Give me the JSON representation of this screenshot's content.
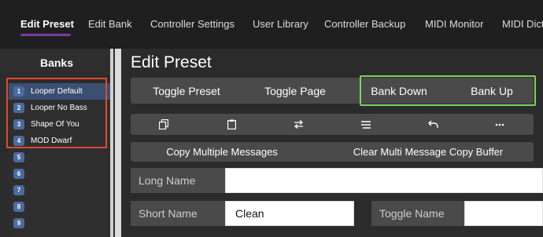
{
  "nav": {
    "tabs": [
      {
        "label": "Edit Preset"
      },
      {
        "label": "Edit Bank"
      },
      {
        "label": "Controller Settings"
      },
      {
        "label": "User Library"
      },
      {
        "label": "Controller Backup"
      },
      {
        "label": "MIDI Monitor"
      },
      {
        "label": "MIDI Dict"
      }
    ]
  },
  "sidebar": {
    "title": "Banks",
    "banks": [
      {
        "num": "1",
        "label": "Looper Default",
        "selected": true
      },
      {
        "num": "2",
        "label": "Looper No Bass"
      },
      {
        "num": "3",
        "label": "Shape Of You"
      },
      {
        "num": "4",
        "label": "MOD Dwarf"
      },
      {
        "num": "5",
        "label": ""
      },
      {
        "num": "6",
        "label": ""
      },
      {
        "num": "7",
        "label": ""
      },
      {
        "num": "8",
        "label": ""
      },
      {
        "num": "9",
        "label": ""
      }
    ]
  },
  "main": {
    "title": "Edit Preset",
    "buttons": {
      "toggle_preset": "Toggle Preset",
      "toggle_page": "Toggle Page",
      "bank_down": "Bank Down",
      "bank_up": "Bank Up"
    },
    "icons": [
      {
        "name": "copy-icon",
        "glyph": "⧉"
      },
      {
        "name": "clipboard-icon",
        "glyph": "📋"
      },
      {
        "name": "swap-icon",
        "glyph": "⇄"
      },
      {
        "name": "list-icon",
        "glyph": "≡"
      },
      {
        "name": "undo-icon",
        "glyph": "↶"
      },
      {
        "name": "more-icon",
        "glyph": "•••"
      }
    ],
    "copy_multiple": "Copy Multiple Messages",
    "clear_buffer": "Clear Multi Message Copy Buffer",
    "long_name_label": "Long Name",
    "long_name_value": "",
    "short_name_label": "Short Name",
    "short_name_value": "Clean",
    "toggle_name_label": "Toggle Name",
    "toggle_name_value": ""
  },
  "colors": {
    "accent": "#7a3aa8",
    "highlight_red": "#e2492c",
    "highlight_green": "#7ad35a"
  }
}
